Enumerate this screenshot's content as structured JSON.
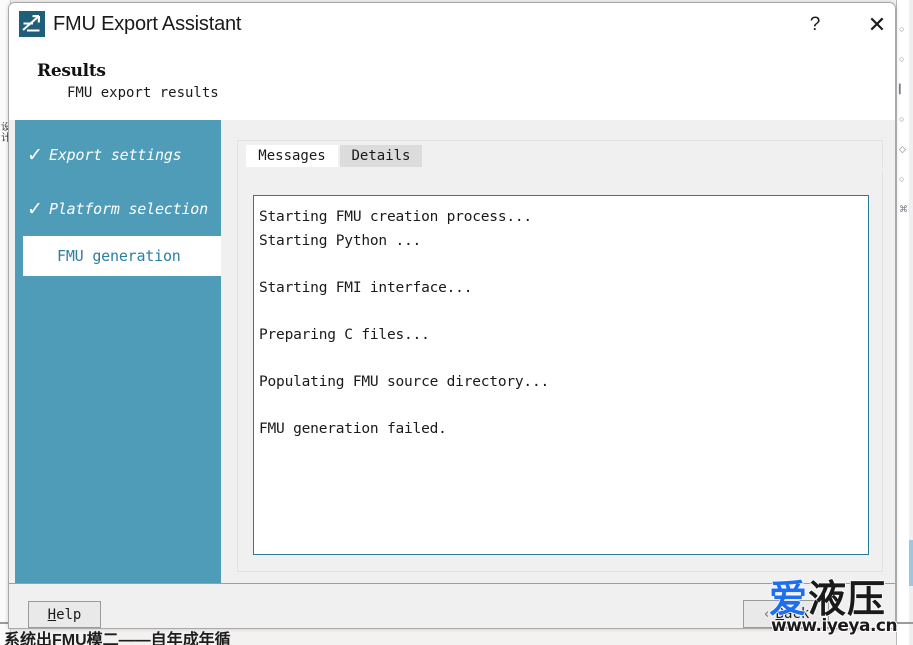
{
  "window": {
    "title": "FMU Export Assistant",
    "icon": "fmu-app-icon",
    "help_button": "?",
    "close_button": "✕"
  },
  "header": {
    "title": "Results",
    "subtitle": "FMU export results"
  },
  "sidebar": {
    "accent_color": "#4f9cb8",
    "active_text_color": "#2b7fa3",
    "steps": [
      {
        "label": "Export settings",
        "completed": true,
        "active": false,
        "check": "✓"
      },
      {
        "label": "Platform selection",
        "completed": true,
        "active": false,
        "check": "✓"
      },
      {
        "label": "FMU generation",
        "completed": false,
        "active": true,
        "check": ""
      }
    ]
  },
  "content": {
    "tabs": [
      {
        "label": "Messages",
        "active": true
      },
      {
        "label": "Details",
        "active": false
      }
    ],
    "log": {
      "border_color": "#2c7a96",
      "lines": [
        "Starting FMU creation process...",
        "Starting Python ...",
        "",
        "Starting FMI interface...",
        "",
        "Preparing C files...",
        "",
        "Populating FMU source directory...",
        "",
        "FMU generation failed."
      ]
    }
  },
  "footer": {
    "help_button": {
      "prefix": "",
      "mnemonic": "H",
      "suffix": "elp"
    },
    "back_button": {
      "chevron": "‹",
      "prefix": "",
      "mnemonic": "B",
      "suffix": "ack"
    }
  },
  "watermark": {
    "char1": "爱",
    "chars_rest": "液压",
    "url": "www.iyeya.cn",
    "blue": "#1e6ef0"
  },
  "background": {
    "bottom_text": "系统出FMU模二——自年成年循",
    "left_glyphs": "设\n计",
    "right_glyphs": [
      "○",
      "○",
      "▎",
      "○",
      "◇",
      "○",
      "⌘"
    ]
  }
}
